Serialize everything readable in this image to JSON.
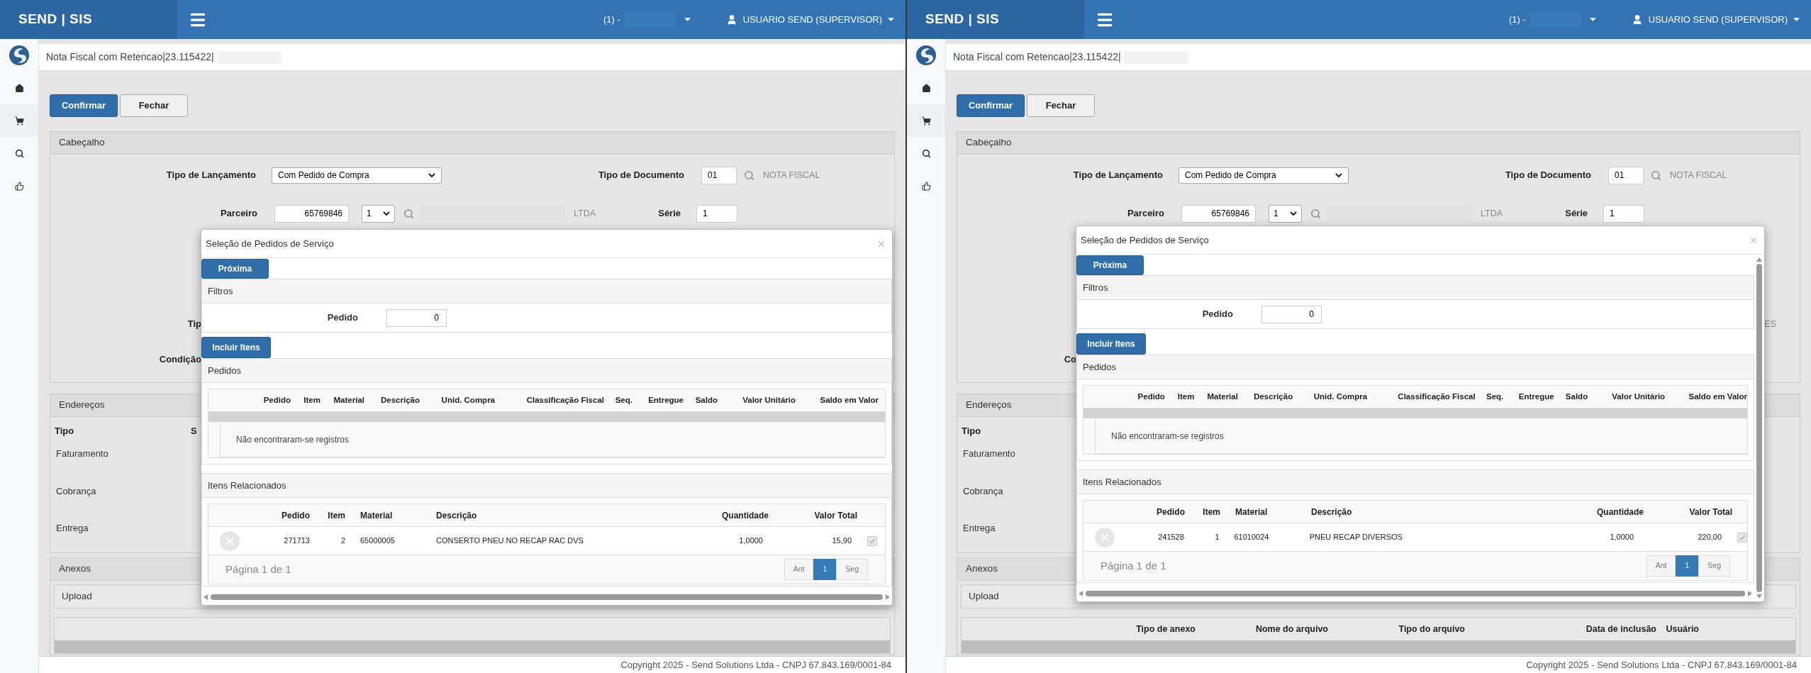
{
  "panes": [
    {
      "header": {
        "brand": "SEND | SIS",
        "company": "(1) -",
        "user": "USUARIO SEND (SUPERVISOR)"
      },
      "page_title": "Nota Fiscal com Retencao|23.115422|",
      "actions": [
        {
          "label": "Confirmar",
          "primary": true
        },
        {
          "label": "Fechar",
          "primary": false
        }
      ],
      "cabecalho": {
        "title": "Cabeçalho",
        "tipo_lancamento": {
          "label": "Tipo de Lançamento",
          "value": "Com Pedido de Compra"
        },
        "tipo_documento": {
          "label": "Tipo de Documento",
          "value": "01",
          "description": "NOTA FISCAL"
        },
        "parceiro": {
          "label": "Parceiro",
          "value": "65769846",
          "branch": "1",
          "name_suffix": "LTDA"
        },
        "serie": {
          "label": "Série",
          "value": "1"
        },
        "partial_rows": [
          {
            "items": [
              {
                "kind": "label",
                "text": "Tip"
              }
            ]
          },
          {
            "items": [
              {
                "kind": "label",
                "text": "Condição"
              }
            ]
          }
        ]
      },
      "enderecos": {
        "title": "Endereços",
        "columns": [
          "Tipo",
          "S"
        ],
        "rows": [
          "Faturamento",
          "Cobrança",
          "Entrega"
        ]
      },
      "anexos": {
        "title": "Anexos",
        "upload": "Upload"
      },
      "footer": "Copyright 2025 - Send Solutions Ltda - CNPJ 67.843.169/0001-84",
      "modal": {
        "title": "Seleção de Pedidos de Serviço",
        "close": "×",
        "next_button": "Próxima",
        "filters": {
          "title": "Filtros",
          "pedido_label": "Pedido",
          "pedido_value": "0"
        },
        "include_button": "Incluir Itens",
        "pedidos": {
          "title": "Pedidos",
          "columns": [
            "Pedido",
            "Item",
            "Material",
            "Descrição",
            "Unid. Compra",
            "Classificação Fiscal",
            "Seq.",
            "Entregue",
            "Saldo",
            "Valor Unitário",
            "Saldo em Valor"
          ],
          "empty": "Não encontraram-se registros"
        },
        "itens": {
          "title": "Itens Relacionados",
          "columns": [
            "Pedido",
            "Item",
            "Material",
            "Descrição",
            "Quantidade",
            "Valor Total"
          ],
          "rows": [
            {
              "pedido": "271713",
              "item": "2",
              "material": "65000005",
              "descricao": "CONSERTO PNEU NO RECAP RAC DVS",
              "quantidade": "1,0000",
              "valor_total": "15,90",
              "checked": true
            }
          ],
          "page_info": "Página 1 de 1",
          "pages": [
            {
              "label": "Ant",
              "selected": false
            },
            {
              "label": "1",
              "selected": true
            },
            {
              "label": "Seg",
              "selected": false
            }
          ]
        }
      }
    },
    {
      "header": {
        "brand": "SEND | SIS",
        "company": "(1) -",
        "user": "USUARIO SEND (SUPERVISOR)"
      },
      "page_title": "Nota Fiscal com Retencao|23.115422|",
      "actions": [
        {
          "label": "Confirmar",
          "primary": true
        },
        {
          "label": "Fechar",
          "primary": false
        }
      ],
      "cabecalho": {
        "title": "Cabeçalho",
        "tipo_lancamento": {
          "label": "Tipo de Lançamento",
          "value": "Com Pedido de Compra"
        },
        "tipo_documento": {
          "label": "Tipo de Documento",
          "value": "01",
          "description": "NOTA FISCAL"
        },
        "parceiro": {
          "label": "Parceiro",
          "value": "65769846",
          "branch": "1",
          "name_suffix": "LTDA"
        },
        "serie": {
          "label": "Série",
          "value": "1"
        },
        "partial_rows": [
          {
            "items": [
              {
                "kind": "trailing",
                "text": "ES"
              }
            ]
          },
          {
            "items": [
              {
                "kind": "label",
                "text": "Co"
              }
            ]
          }
        ]
      },
      "enderecos": {
        "title": "Endereços",
        "columns": [
          "Tipo"
        ],
        "rows": [
          "Faturamento",
          "Cobrança",
          "Entrega"
        ]
      },
      "anexos": {
        "title": "Anexos",
        "upload": "Upload",
        "columns": [
          "Tipo de anexo",
          "Nome do arquivo",
          "Tipo do arquivo",
          "Data de inclusão",
          "Usuário"
        ]
      },
      "footer": "Copyright 2025 - Send Solutions Ltda - CNPJ 67.843.169/0001-84",
      "modal": {
        "title": "Seleção de Pedidos de Serviço",
        "close": "×",
        "next_button": "Próxima",
        "filters": {
          "title": "Filtros",
          "pedido_label": "Pedido",
          "pedido_value": "0"
        },
        "include_button": "Incluir Itens",
        "pedidos": {
          "title": "Pedidos",
          "columns": [
            "Pedido",
            "Item",
            "Material",
            "Descrição",
            "Unid. Compra",
            "Classificação Fiscal",
            "Seq.",
            "Entregue",
            "Saldo",
            "Valor Unitário",
            "Saldo em Valor"
          ],
          "empty": "Não encontraram-se registros"
        },
        "itens": {
          "title": "Itens Relacionados",
          "columns": [
            "Pedido",
            "Item",
            "Material",
            "Descrição",
            "Quantidade",
            "Valor Total"
          ],
          "rows": [
            {
              "pedido": "241528",
              "item": "1",
              "material": "61010024",
              "descricao": "PNEU RECAP DIVERSOS",
              "quantidade": "1,0000",
              "valor_total": "220,00",
              "checked": true
            }
          ],
          "page_info": "Página 1 de 1",
          "pages": [
            {
              "label": "Ant",
              "selected": false
            },
            {
              "label": "1",
              "selected": true
            },
            {
              "label": "Seg",
              "selected": false
            }
          ]
        }
      }
    }
  ]
}
